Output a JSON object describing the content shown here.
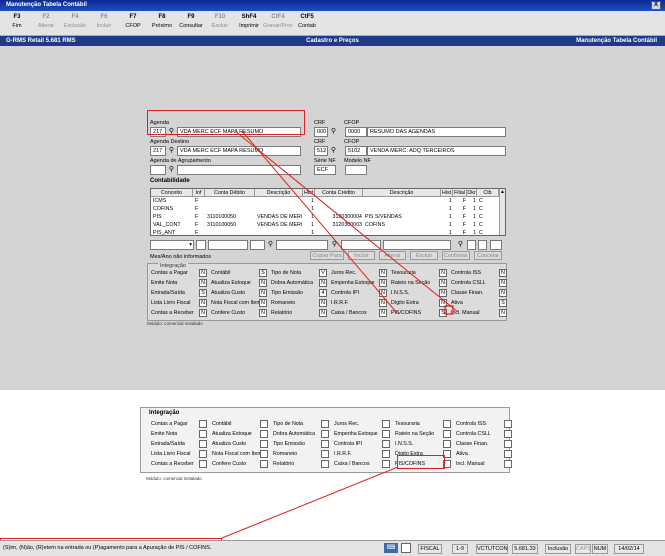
{
  "window": {
    "title": "Manutenção Tabela Contábil",
    "close": "X"
  },
  "toolbar": [
    {
      "key": "F3",
      "label": "Fim",
      "enabled": true
    },
    {
      "key": "F2",
      "label": "Alterar",
      "enabled": false
    },
    {
      "key": "F4",
      "label": "Exclusão",
      "enabled": false
    },
    {
      "key": "F6",
      "label": "Incluir",
      "enabled": false
    },
    {
      "key": "F7",
      "label": "CFOP",
      "enabled": true
    },
    {
      "key": "F8",
      "label": "Próximo",
      "enabled": true
    },
    {
      "key": "F9",
      "label": "Consultar",
      "enabled": true
    },
    {
      "key": "F10",
      "label": "Excluir",
      "enabled": false
    },
    {
      "key": "ShF4",
      "label": "Imprimir",
      "enabled": true
    },
    {
      "key": "CtF4",
      "label": "Gravar/Proc",
      "enabled": false
    },
    {
      "key": "CtF5",
      "label": "Contab",
      "enabled": true
    }
  ],
  "header": {
    "left": "G-RMS Retail 5.681 RMS",
    "center": "Cadastro e Preços",
    "right": "Manutenção Tabela Contábil"
  },
  "form": {
    "agenda_label": "Agenda",
    "agenda_code": "217",
    "agenda_desc": "VDA MERC ECF MAPA RESUMO",
    "crf_label": "CRF",
    "crf1": "000",
    "cfop_label": "CFOP",
    "cfop1_code": "0000",
    "cfop1_desc": "RESUMO DAS AGENDAS",
    "agenda_destino_label": "Agenda Destino",
    "dest_code": "217",
    "dest_desc": "VDA MERC ECF MAPA RESUMO",
    "crf2": "512",
    "cfop2_code": "5102",
    "cfop2_desc": "VENDA MERC. ADQ TERCEIROS",
    "agrup_label": "Agenda de Agrupamento",
    "serie_label": "Série NF",
    "serie_value": "ECF",
    "modelo_label": "Modelo NF"
  },
  "contab": {
    "title": "Contabilidade",
    "headers": [
      "Conceito",
      "Inf",
      "Conta Débito",
      "Descrição",
      "Hist",
      "Conta Crédito",
      "Descrição",
      "Hist",
      "Filial",
      "Dkr",
      "Ctb"
    ],
    "rows": [
      [
        "ICMS",
        "F",
        "",
        "",
        "1",
        "",
        "",
        "1",
        "F",
        "1",
        "C"
      ],
      [
        "COFINS",
        "F",
        "",
        "",
        "1",
        "",
        "",
        "1",
        "F",
        "1",
        "C"
      ],
      [
        "PIS",
        "F",
        "3110100050",
        "VENDAS DE MERC",
        "1",
        "3120300004",
        "PIS S/VENDAS",
        "1",
        "F",
        "1",
        "C"
      ],
      [
        "VAL_CONT",
        "F",
        "3110100050",
        "VENDAS DE MERC",
        "1",
        "3120300003",
        "COFINS",
        "1",
        "F",
        "1",
        "C"
      ],
      [
        "PIS_ANT",
        "F",
        "",
        "",
        "1",
        "",
        "",
        "1",
        "F",
        "1",
        "C"
      ]
    ],
    "mes_ano": "Mes/Ano não informados",
    "buttons": [
      "Copiar Para",
      "Incluir",
      "Alterar",
      "Excluir",
      "Confirmar",
      "Cancelar"
    ]
  },
  "integ": {
    "title": "Integração",
    "items": [
      {
        "label": "Contas a Pagar",
        "v": "N"
      },
      {
        "label": "Contábil",
        "v": "S"
      },
      {
        "label": "Tipo de Nota",
        "v": "V"
      },
      {
        "label": "Juros Rec.",
        "v": "N"
      },
      {
        "label": "Tesouraria",
        "v": "N"
      },
      {
        "label": "Controla ISS",
        "v": "N"
      },
      {
        "label": "Emite Nota",
        "v": "N"
      },
      {
        "label": "Atualiza Estoque",
        "v": "N"
      },
      {
        "label": "Dobra Automática",
        "v": "N"
      },
      {
        "label": "Empenha Estoque",
        "v": "N"
      },
      {
        "label": "Rateio na Seção",
        "v": "N"
      },
      {
        "label": "Controla CSLL",
        "v": "N"
      },
      {
        "label": "Entrada/Saída",
        "v": "S"
      },
      {
        "label": "Atualiza Custo",
        "v": "N"
      },
      {
        "label": "Tipo Emissão",
        "v": "4"
      },
      {
        "label": "Controla IPI",
        "v": "N"
      },
      {
        "label": "I.N.S.S.",
        "v": "N"
      },
      {
        "label": "Classe Finan.",
        "v": "N"
      },
      {
        "label": "Lista Livro Fiscal",
        "v": "N"
      },
      {
        "label": "Nota Fiscal com Item",
        "v": "N"
      },
      {
        "label": "Romaneio",
        "v": "N"
      },
      {
        "label": "I.R.R.F.",
        "v": "N"
      },
      {
        "label": "Dígito Extra",
        "v": "N"
      },
      {
        "label": "Ativa",
        "v": "S"
      },
      {
        "label": "Contas a Receber",
        "v": "N"
      },
      {
        "label": "Confere Custo",
        "v": "N"
      },
      {
        "label": "Relatório",
        "v": "N"
      },
      {
        "label": "Caixa / Bancos",
        "v": "N"
      },
      {
        "label": "PIS/COFINS",
        "v": "S"
      },
      {
        "label": "Incl. Manual",
        "v": "N"
      }
    ],
    "modulo": "Módulo: comercial instalado"
  },
  "integ2": {
    "title": "Integração",
    "items": [
      {
        "label": "Contas a Pagar"
      },
      {
        "label": "Contábil"
      },
      {
        "label": "Tipo de Nota"
      },
      {
        "label": "Juros Rec."
      },
      {
        "label": "Tesouraria"
      },
      {
        "label": "Controla ISS"
      },
      {
        "label": "Emite Nota"
      },
      {
        "label": "Atualiza Estoque"
      },
      {
        "label": "Dobra Automática"
      },
      {
        "label": "Empenha Estoque"
      },
      {
        "label": "Rateio na Seção"
      },
      {
        "label": "Controla CSLL"
      },
      {
        "label": "Entrada/Saída"
      },
      {
        "label": "Atualiza Custo"
      },
      {
        "label": "Tipo Emissão"
      },
      {
        "label": "Controla IPI"
      },
      {
        "label": "I.N.S.S."
      },
      {
        "label": "Classe Finan."
      },
      {
        "label": "Lista Livro Fiscal"
      },
      {
        "label": "Nota Fiscal com Item"
      },
      {
        "label": "Romaneio"
      },
      {
        "label": "I.R.R.F."
      },
      {
        "label": "Dígito Extra"
      },
      {
        "label": "Ativa"
      },
      {
        "label": "Contas a Receber"
      },
      {
        "label": "Confere Custo"
      },
      {
        "label": "Relatório"
      },
      {
        "label": "Caixa / Bancos"
      },
      {
        "label": "PIS/COFINS"
      },
      {
        "label": "Incl. Manual"
      }
    ],
    "modulo": "Módulo: comercial instalado"
  },
  "status": {
    "message": "(S)im, (N)ão, (R)etem na entrada ou (P)agamento para a Apuração de PIS / COFINS.",
    "fiscal": "FISCAL",
    "page": "1-9",
    "user": "VCTUTCON",
    "version": "5.681.33",
    "mode": "Inclusão",
    "caps": "CAPS",
    "num": "NUM",
    "date": "14/02/14"
  }
}
